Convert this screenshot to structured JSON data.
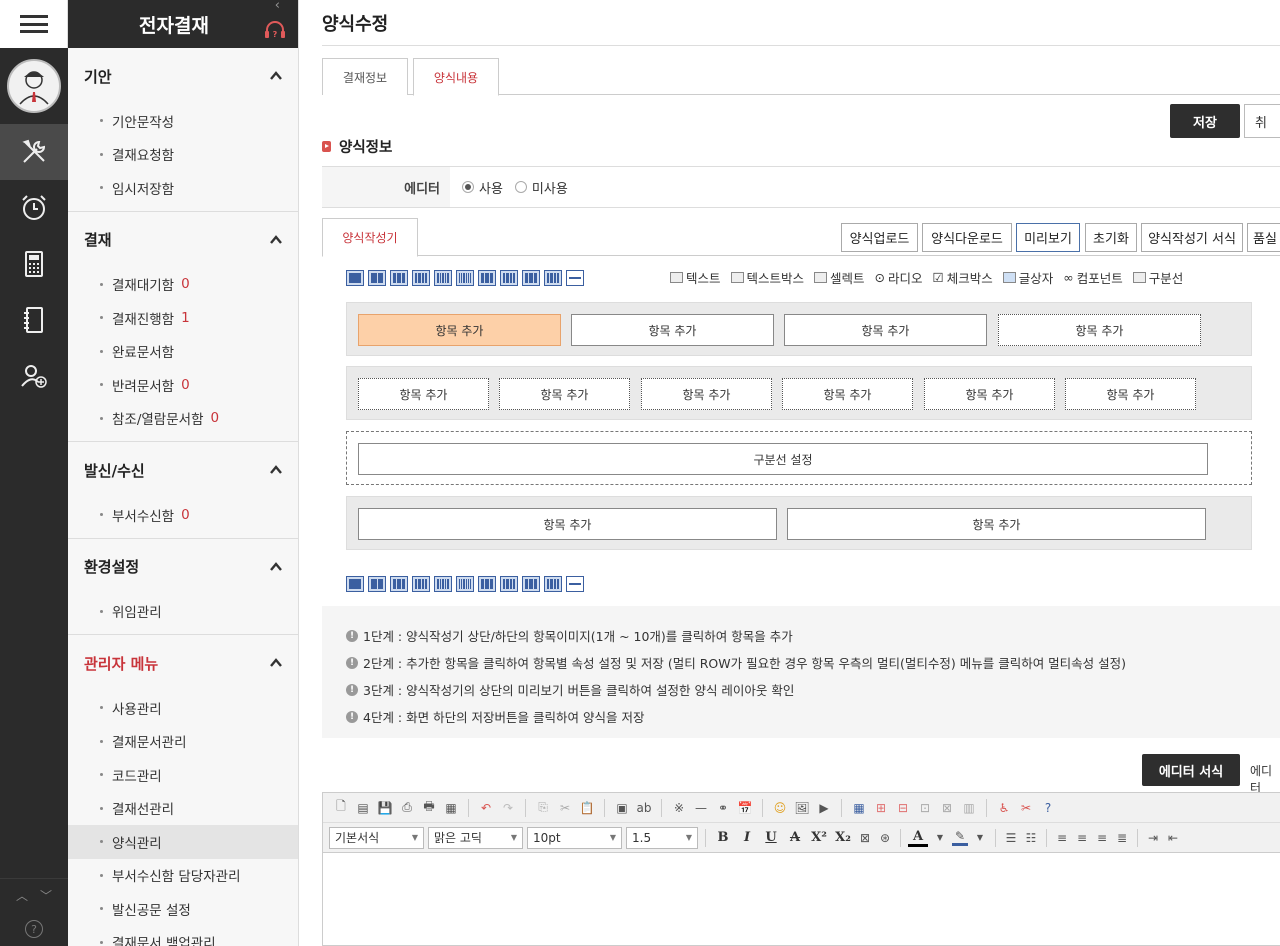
{
  "app": {
    "title": "전자결재"
  },
  "page": {
    "title": "양식수정"
  },
  "tabs": [
    {
      "label": "결재정보"
    },
    {
      "label": "양식내용"
    }
  ],
  "actions": {
    "save": "저장",
    "cancel": "취"
  },
  "section": {
    "title": "양식정보"
  },
  "editor_setting": {
    "label": "에디터",
    "options": [
      {
        "label": "사용",
        "selected": true
      },
      {
        "label": "미사용",
        "selected": false
      }
    ]
  },
  "builder": {
    "tab": "양식작성기",
    "buttons": [
      "양식업로드",
      "양식다운로드",
      "미리보기",
      "초기화",
      "양식작성기 서식",
      "품실"
    ],
    "legend": [
      "텍스트",
      "텍스트박스",
      "셀렉트",
      "라디오",
      "체크박스",
      "글상자",
      "컴포넌트",
      "구분선"
    ],
    "row1": [
      "항목 추가",
      "항목 추가",
      "항목 추가",
      "항목 추가"
    ],
    "row2": [
      "항목 추가",
      "항목 추가",
      "항목 추가",
      "항목 추가",
      "항목 추가",
      "항목 추가"
    ],
    "divider": "구분선 설정",
    "row3": [
      "항목 추가",
      "항목 추가"
    ],
    "steps": [
      "1단계 : 양식작성기 상단/하단의 항목이미지(1개 ~ 10개)를 클릭하여 항목을 추가",
      "2단계 : 추가한 항목을 클릭하여 항목별 속성 설정 및 저장 (멀티 ROW가 필요한 경우 항목 우측의 멀티(멀티수정) 메뉴를 클릭하여 멀티속성 설정)",
      "3단계 : 양식작성기의 상단의 미리보기 버튼을 클릭하여 설정한 양식 레이아웃 확인",
      "4단계 : 화면 하단의 저장버튼을 클릭하여 양식을 저장"
    ]
  },
  "editor": {
    "format_btn": "에디터 서식",
    "format_btn2": "에디터",
    "style": "기본서식",
    "font": "맑은 고딕",
    "size": "10pt",
    "line": "1.5"
  },
  "sidebar": {
    "sections": [
      {
        "title": "기안",
        "items": [
          {
            "label": "기안문작성"
          },
          {
            "label": "결재요청함"
          },
          {
            "label": "임시저장함"
          }
        ]
      },
      {
        "title": "결재",
        "items": [
          {
            "label": "결재대기함",
            "count": "0"
          },
          {
            "label": "결재진행함",
            "count": "1"
          },
          {
            "label": "완료문서함"
          },
          {
            "label": "반려문서함",
            "count": "0"
          },
          {
            "label": "참조/열람문서함",
            "count": "0"
          }
        ]
      },
      {
        "title": "발신/수신",
        "items": [
          {
            "label": "부서수신함",
            "count": "0"
          }
        ]
      },
      {
        "title": "환경설정",
        "items": [
          {
            "label": "위임관리"
          }
        ]
      },
      {
        "title": "관리자 메뉴",
        "items": [
          {
            "label": "사용관리"
          },
          {
            "label": "결재문서관리"
          },
          {
            "label": "코드관리"
          },
          {
            "label": "결재선관리"
          },
          {
            "label": "양식관리"
          },
          {
            "label": "부서수신함 담당자관리"
          },
          {
            "label": "발신공문 설정"
          },
          {
            "label": "결재문서 백업관리"
          }
        ]
      }
    ]
  },
  "colors": {
    "accent": "#c8343a",
    "dark": "#2b2b2b",
    "highlight": "#fdd0a8"
  }
}
